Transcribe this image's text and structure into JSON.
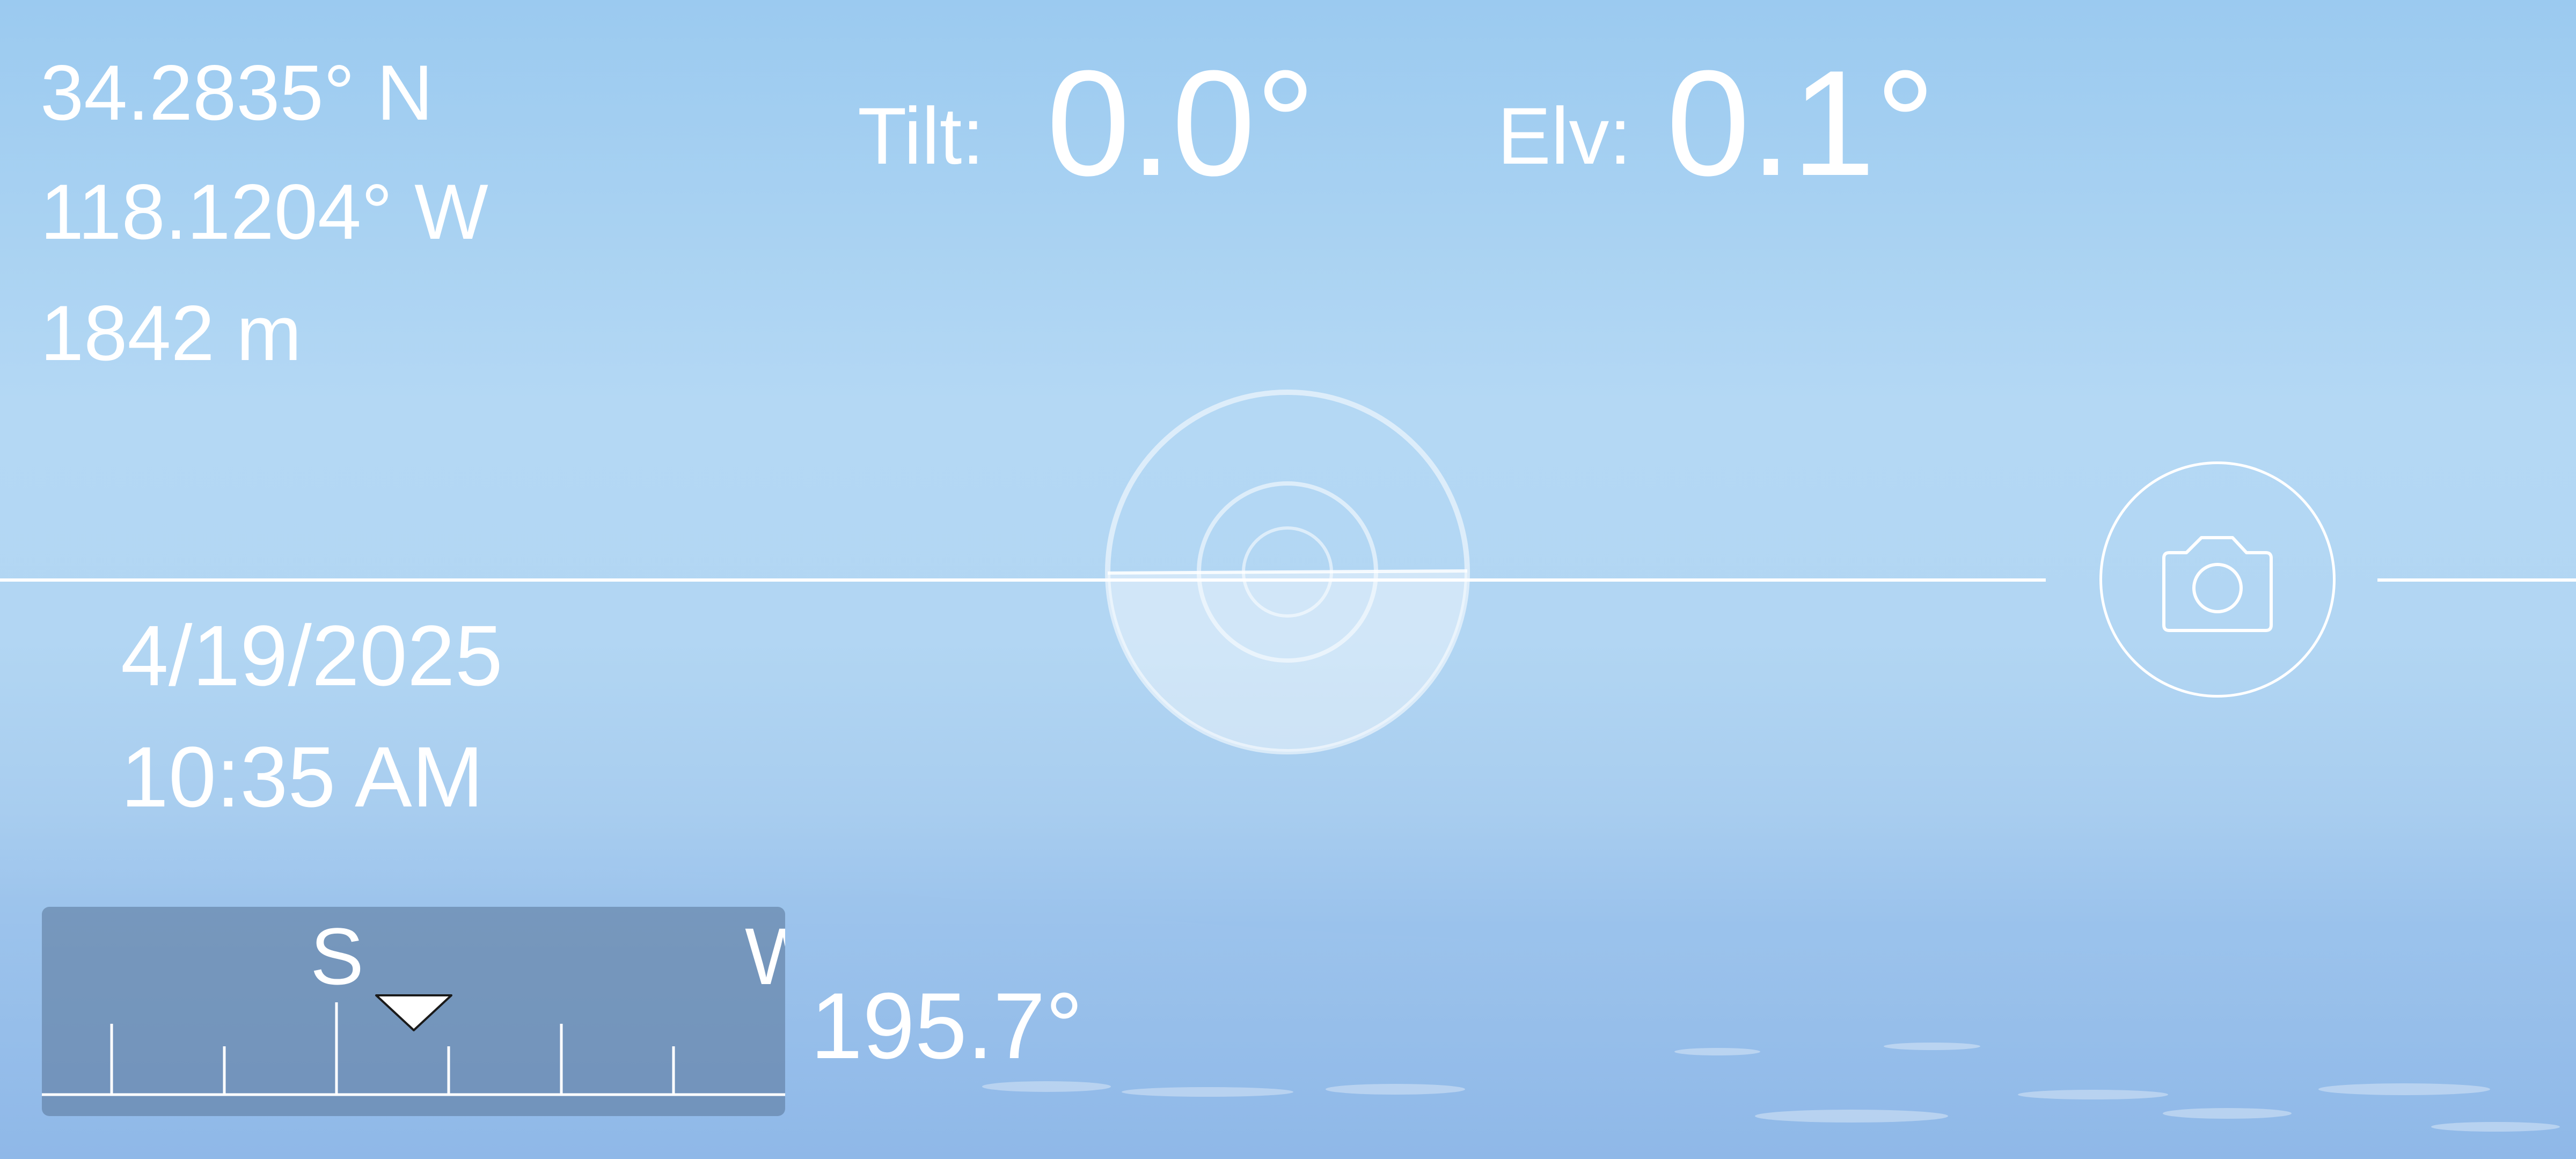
{
  "location": {
    "latitude": "34.2835° N",
    "longitude": "118.1204° W",
    "altitude": "1842 m"
  },
  "tilt": {
    "label": "Tilt:",
    "value": "0.0°"
  },
  "elevation": {
    "label": "Elv:",
    "value": "0.1°"
  },
  "datetime": {
    "date": "4/19/2025",
    "time": "10:35 AM"
  },
  "compass": {
    "letters": [
      "S",
      "W"
    ],
    "heading": "195.7°"
  },
  "icons": {
    "level": "level-indicator-icon",
    "camera": "camera-icon",
    "heading_pointer": "triangle-pointer-icon"
  },
  "colors": {
    "text": "#ffffff",
    "compass_panel": "#607da0"
  }
}
